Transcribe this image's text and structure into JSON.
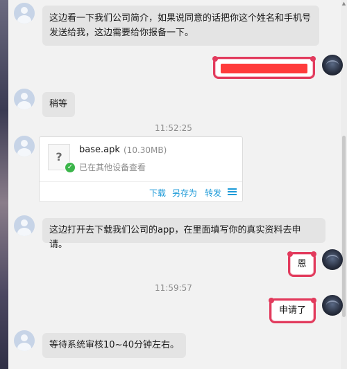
{
  "messages": {
    "m1_text": "这边看一下我们公司简介，如果说同意的话把你这个姓名和手机号发送给我，这边需要给你报备一下。",
    "m3_text": "稍等",
    "m5_text": "这边打开去下载我们公司的app，在里面填写你的真实资料去申请。",
    "m6_text": "恩",
    "m7_text": "申请了",
    "m8_text": "等待系统审核10~40分钟左右。"
  },
  "timestamps": {
    "t1": "11:52:25",
    "t2": "11:59:57"
  },
  "file": {
    "icon": "?",
    "name": "base.apk",
    "size": "(10.30MB)",
    "status": "已在其他设备查看",
    "actions": {
      "download": "下载",
      "save_as": "另存为",
      "forward": "转发"
    }
  },
  "colors": {
    "self_bubble_border": "#e23b5d",
    "redaction": "#ff3b3b",
    "link": "#1c9ad8",
    "other_bubble": "#e4e4e4"
  }
}
